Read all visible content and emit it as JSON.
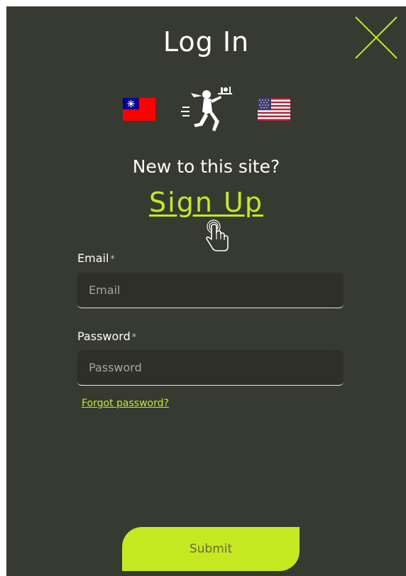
{
  "dialog": {
    "title": "Log In",
    "new_to_site": "New to this site?",
    "signup_label": "Sign Up"
  },
  "form": {
    "email": {
      "label": "Email",
      "required_mark": "*",
      "placeholder": "Email",
      "value": ""
    },
    "password": {
      "label": "Password",
      "required_mark": "*",
      "placeholder": "Password",
      "value": ""
    },
    "forgot_label": "Forgot password?",
    "submit_label": "Submit"
  },
  "icons": {
    "close": "close-icon",
    "flag_left": "taiwan-flag-icon",
    "flag_right": "us-flag-icon",
    "logo": "waiter-mascot-logo",
    "pointer": "hand-pointer-icon"
  },
  "colors": {
    "background": "#373A31",
    "accent": "#C5E820",
    "input_background": "#2F2F2A",
    "text": "#FFFFFF"
  }
}
